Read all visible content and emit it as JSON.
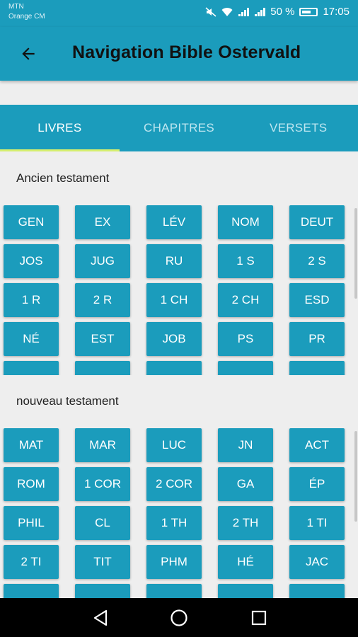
{
  "status_bar": {
    "carrier_line1": "MTN",
    "carrier_line2": "Orange CM",
    "battery_percent": "50 %",
    "time": "17:05",
    "icons": [
      "mute-icon",
      "wifi-icon",
      "signal-icon",
      "battery-icon"
    ]
  },
  "app_bar": {
    "title": "Navigation Bible Ostervald",
    "back_icon": "arrow-left-icon"
  },
  "tabs": [
    {
      "label": "LIVRES",
      "active": true
    },
    {
      "label": "CHAPITRES",
      "active": false
    },
    {
      "label": "VERSETS",
      "active": false
    }
  ],
  "old_testament": {
    "title": "Ancien testament",
    "books": [
      "GEN",
      "EX",
      "LÉV",
      "NOM",
      "DEUT",
      "JOS",
      "JUG",
      "RU",
      "1 S",
      "2 S",
      "1 R",
      "2 R",
      "1 CH",
      "2 CH",
      "ESD",
      "NÉ",
      "EST",
      "JOB",
      "PS",
      "PR"
    ]
  },
  "new_testament": {
    "title": "nouveau testament",
    "books": [
      "MAT",
      "MAR",
      "LUC",
      "JN",
      "ACT",
      "ROM",
      "1 COR",
      "2 COR",
      "GA",
      "ÉP",
      "PHIL",
      "CL",
      "1 TH",
      "2 TH",
      "1 TI",
      "2 TI",
      "TIT",
      "PHM",
      "HÉ",
      "JAC"
    ]
  },
  "nav_bar": {
    "icons": [
      "back-triangle-icon",
      "home-circle-icon",
      "recents-square-icon"
    ]
  },
  "colors": {
    "accent": "#1b9cbc",
    "tab_indicator": "#d6ef6e",
    "background": "#eeeeee"
  }
}
